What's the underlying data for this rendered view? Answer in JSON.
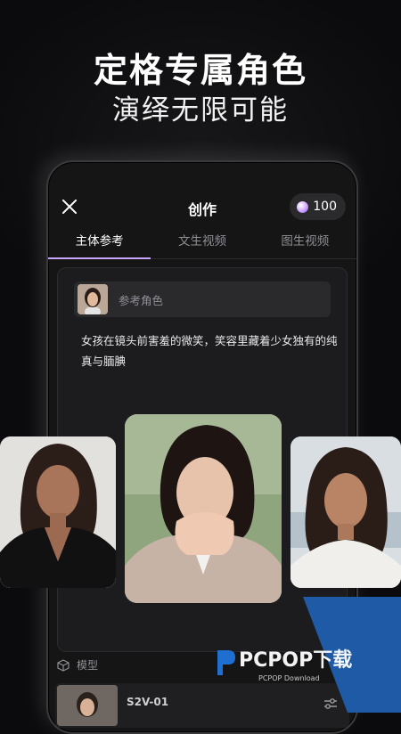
{
  "promo": {
    "headline": "定格专属角色",
    "subheadline": "演绎无限可能"
  },
  "app": {
    "title": "创作",
    "credits": "100",
    "tabs": [
      {
        "label": "主体参考",
        "active": true
      },
      {
        "label": "文生视频",
        "active": false
      },
      {
        "label": "图生视频",
        "active": false
      }
    ],
    "reference_label": "参考角色",
    "prompt_text": "女孩在镜头前害羞的微笑，笑容里藏着少女独有的纯真与腼腆",
    "model_section_label": "模型",
    "model_name": "S2V-01"
  },
  "watermark": {
    "brand": "PCPOP下载",
    "sub": "PCPOP Download"
  },
  "colors": {
    "accent": "#c8a6ff",
    "background": "#0b0b0d",
    "watermark_blue": "#1f5aa6"
  }
}
